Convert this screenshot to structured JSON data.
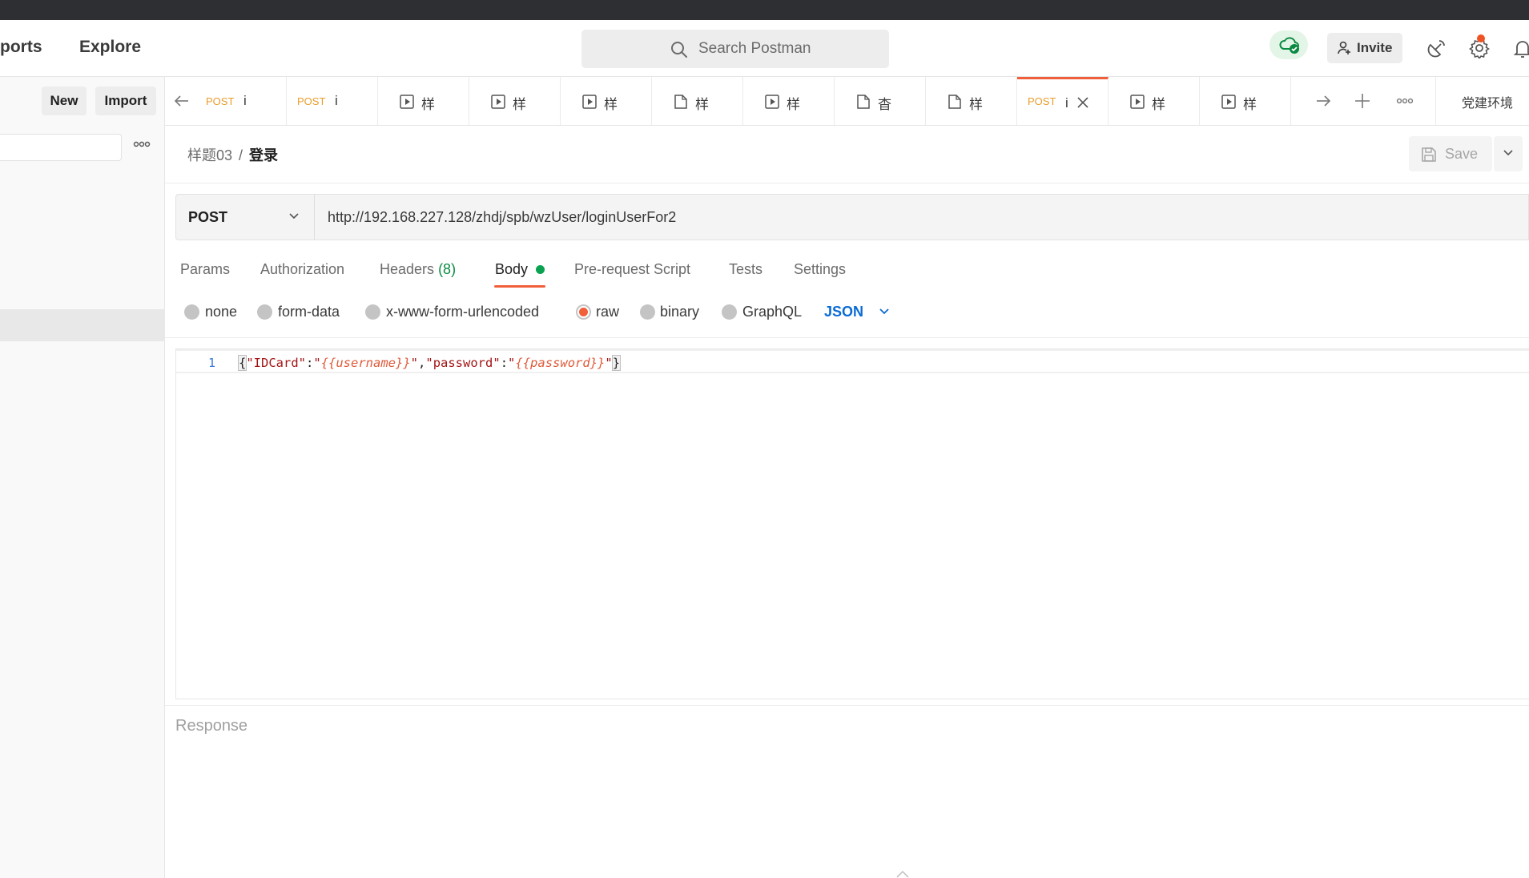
{
  "header": {
    "nav_reports": "ports",
    "nav_explore": "Explore",
    "search_placeholder": "Search Postman",
    "invite_label": "Invite",
    "accent_color": "#f05f3a"
  },
  "sidebar": {
    "new_label": "New",
    "import_label": "Import"
  },
  "tabs": [
    {
      "method": "POST",
      "name": "i",
      "type": "request"
    },
    {
      "method": "POST",
      "name": "i",
      "type": "request"
    },
    {
      "method": "",
      "name": "样",
      "type": "runner"
    },
    {
      "method": "",
      "name": "样",
      "type": "runner"
    },
    {
      "method": "",
      "name": "样",
      "type": "runner"
    },
    {
      "method": "",
      "name": "样",
      "type": "collection"
    },
    {
      "method": "",
      "name": "样",
      "type": "runner"
    },
    {
      "method": "",
      "name": "杳",
      "type": "collection"
    },
    {
      "method": "",
      "name": "样",
      "type": "collection"
    },
    {
      "method": "POST",
      "name": "i",
      "type": "request",
      "active": true
    },
    {
      "method": "",
      "name": "样",
      "type": "runner"
    },
    {
      "method": "",
      "name": "样",
      "type": "runner"
    }
  ],
  "environment": "党建环境",
  "breadcrumb": {
    "parent": "样题03",
    "separator": "/",
    "current": "登录"
  },
  "save_label": "Save",
  "request": {
    "method": "POST",
    "url": "http://192.168.227.128/zhdj/spb/wzUser/loginUserFor2"
  },
  "request_tabs": {
    "params": "Params",
    "authorization": "Authorization",
    "headers": "Headers",
    "headers_count": "(8)",
    "body": "Body",
    "prerequest": "Pre-request Script",
    "tests": "Tests",
    "settings": "Settings"
  },
  "body_options": {
    "none": "none",
    "form_data": "form-data",
    "urlencoded": "x-www-form-urlencoded",
    "raw": "raw",
    "binary": "binary",
    "graphql": "GraphQL",
    "format": "JSON",
    "selected": "raw"
  },
  "editor": {
    "line_number": "1",
    "open_brace": "{",
    "key1": "\"IDCard\"",
    "colon": ":",
    "quote": "\"",
    "var1": "{{username}}",
    "comma": ",",
    "key2": "\"password\"",
    "var2": "{{password}}",
    "close_brace": "}"
  },
  "response_label": "Response"
}
